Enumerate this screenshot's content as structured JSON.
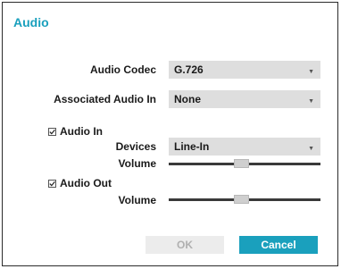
{
  "dialog": {
    "title": "Audio"
  },
  "fields": {
    "audio_codec": {
      "label": "Audio Codec",
      "value": "G.726"
    },
    "associated_audio_in": {
      "label": "Associated Audio In",
      "value": "None"
    },
    "devices": {
      "label": "Devices",
      "value": "Line-In"
    }
  },
  "audio_in": {
    "label": "Audio In",
    "checked": true,
    "volume_label": "Volume",
    "volume_level": 0.48
  },
  "audio_out": {
    "label": "Audio Out",
    "checked": true,
    "volume_label": "Volume",
    "volume_level": 0.48
  },
  "buttons": {
    "ok": "OK",
    "cancel": "Cancel"
  },
  "icons": {
    "dropdown": "chevron-down-icon",
    "checkbox": "checkmark-icon"
  },
  "colors": {
    "accent": "#1aa0bd",
    "disabled_text": "#b0b0b0"
  }
}
